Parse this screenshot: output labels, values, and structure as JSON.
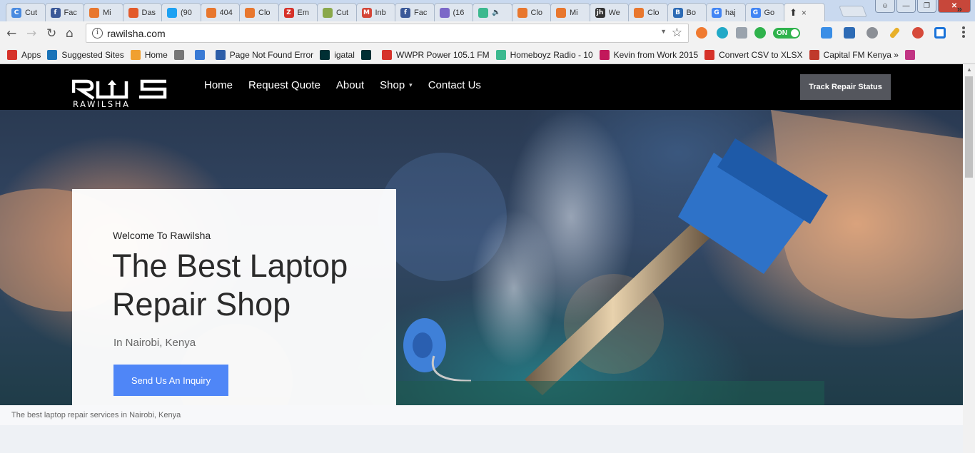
{
  "browser": {
    "tabs": [
      {
        "title": "Cut",
        "color": "#4a8be0",
        "glyph": "C"
      },
      {
        "title": "Fac",
        "color": "#3b5998",
        "glyph": "f"
      },
      {
        "title": "Mi",
        "color": "#e8772e",
        "glyph": ""
      },
      {
        "title": "Das",
        "color": "#e35a2a",
        "glyph": ""
      },
      {
        "title": "(90",
        "color": "#1da1f2",
        "glyph": ""
      },
      {
        "title": "404",
        "color": "#e8772e",
        "glyph": ""
      },
      {
        "title": "Clo",
        "color": "#e8772e",
        "glyph": ""
      },
      {
        "title": "Em",
        "color": "#d6322a",
        "glyph": "Z"
      },
      {
        "title": "Cut",
        "color": "#8aa84a",
        "glyph": ""
      },
      {
        "title": "Inb",
        "color": "#d44638",
        "glyph": "M"
      },
      {
        "title": "Fac",
        "color": "#3b5998",
        "glyph": "f"
      },
      {
        "title": "(16",
        "color": "#7b68c8",
        "glyph": ""
      },
      {
        "title": "",
        "color": "#3cb98f",
        "glyph": "",
        "audio": true
      },
      {
        "title": "Clo",
        "color": "#e8772e",
        "glyph": ""
      },
      {
        "title": "Mi",
        "color": "#e8772e",
        "glyph": ""
      },
      {
        "title": "We",
        "color": "#333333",
        "glyph": "jh"
      },
      {
        "title": "Clo",
        "color": "#e8772e",
        "glyph": ""
      },
      {
        "title": "Bo",
        "color": "#2d6bb5",
        "glyph": "B"
      },
      {
        "title": "haj",
        "color": "#4285f4",
        "glyph": "G"
      },
      {
        "title": "Go",
        "color": "#4285f4",
        "glyph": "G"
      }
    ],
    "active_tab_icon": "upload-icon",
    "active_tab_close": "×",
    "url": "rawilsha.com",
    "extension_toggle": "ON",
    "bookmarks": [
      {
        "label": "Apps",
        "color": "#d6322a",
        "icon": "apps-grid-icon"
      },
      {
        "label": "Suggested Sites",
        "color": "#1a73b8",
        "icon": "bing-icon"
      },
      {
        "label": "Home",
        "color": "#f0a030",
        "icon": "joomla-icon"
      },
      {
        "label": "",
        "color": "#777777",
        "icon": "swirl-icon"
      },
      {
        "label": "",
        "color": "#3a7bd5",
        "icon": "m-circle-icon"
      },
      {
        "label": "Page Not Found Error",
        "color": "#2d5ea8",
        "icon": "p-icon"
      },
      {
        "label": "igatal",
        "color": "#002f34",
        "icon": "olx-icon"
      },
      {
        "label": "",
        "color": "#002f34",
        "icon": "olx-icon"
      },
      {
        "label": "WWPR Power 105.1 FM",
        "color": "#d6322a",
        "icon": "radio-icon"
      },
      {
        "label": "Homeboyz Radio - 10",
        "color": "#3cb98f",
        "icon": "plus-icon"
      },
      {
        "label": "Kevin from Work 2015",
        "color": "#c2185b",
        "icon": "ez-icon"
      },
      {
        "label": "Convert CSV to XLSX",
        "color": "#d6322a",
        "icon": "block-icon"
      },
      {
        "label": "Capital FM Kenya » ",
        "color": "#c0392b",
        "icon": "capital-icon"
      },
      {
        "label": "",
        "color": "#c13584",
        "icon": "instagram-icon"
      }
    ],
    "bookmarks_more": "»"
  },
  "site": {
    "logo_text": "RAWILSHA",
    "logo_mark": "RWS",
    "nav": [
      {
        "label": "Home",
        "dropdown": false
      },
      {
        "label": "Request Quote",
        "dropdown": false
      },
      {
        "label": "About",
        "dropdown": false
      },
      {
        "label": "Shop",
        "dropdown": true
      },
      {
        "label": "Contact Us",
        "dropdown": false
      }
    ],
    "track_button": "Track Repair Status",
    "hero": {
      "welcome": "Welcome To Rawilsha",
      "headline": "The Best Laptop Repair Shop",
      "location": "In Nairobi, Kenya",
      "cta": "Send Us An Inquiry",
      "caption": "The best laptop repair services in Nairobi, Kenya"
    }
  },
  "colors": {
    "header_bg": "#000000",
    "cta_blue": "#4f86f7",
    "track_button_bg": "#54565d"
  }
}
